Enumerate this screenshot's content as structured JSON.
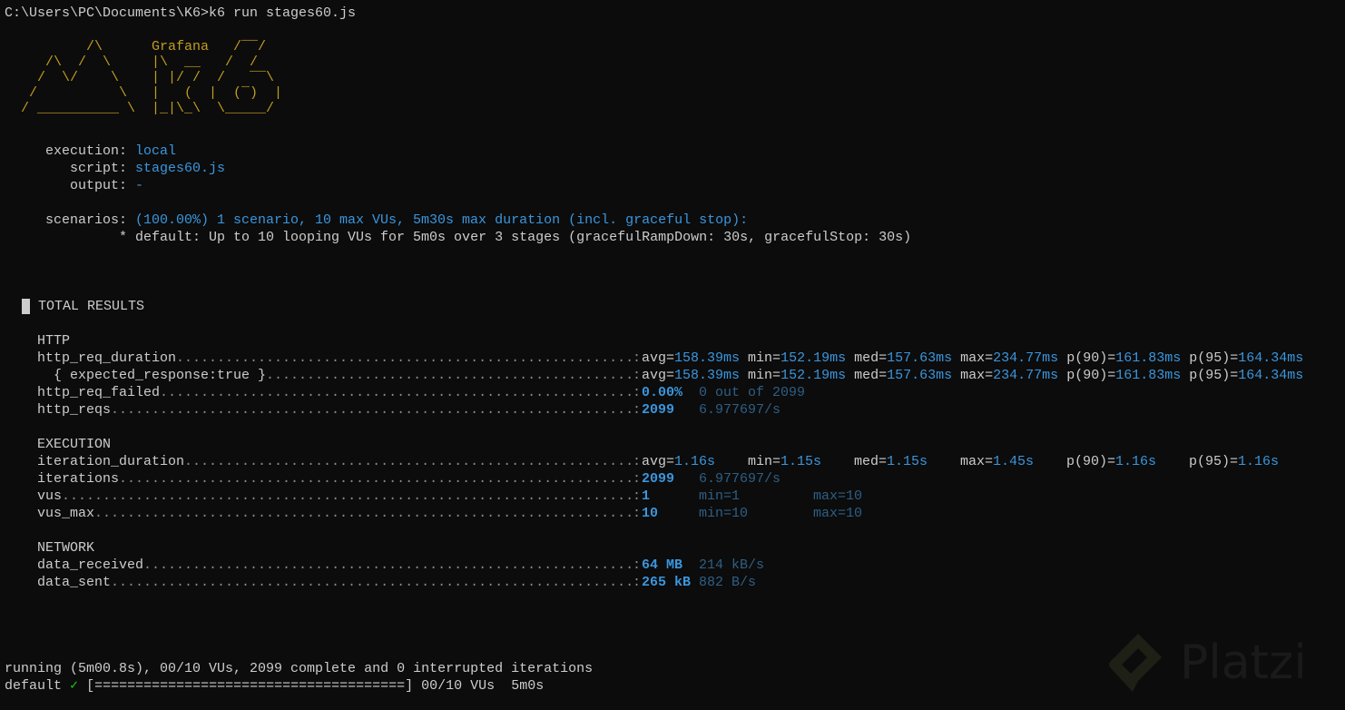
{
  "command_line": "C:\\Users\\PC\\Documents\\K6>k6 run stages60.js",
  "logo": {
    "lines": [
      "          /\\      Grafana   /‾‾/",
      "     /\\  /  \\     |\\  __   /  /",
      "    /  \\/    \\    | |/ /  /   ‾‾\\",
      "   /          \\   |   (  |  (‾)  |",
      "  / __________ \\  |_|\\_\\  \\_____/"
    ]
  },
  "info": {
    "execution_label": "execution:",
    "execution": "local",
    "script_label": "script:",
    "script": "stages60.js",
    "output_label": "output:",
    "output": "-",
    "scenarios_label": "scenarios:",
    "scenarios": "(100.00%) 1 scenario, 10 max VUs, 5m30s max duration (incl. graceful stop):",
    "default_line": "* default: Up to 10 looping VUs for 5m0s over 3 stages (gracefulRampDown: 30s, gracefulStop: 30s)"
  },
  "results_title": "TOTAL RESULTS",
  "http": {
    "title": "HTTP",
    "req_duration": {
      "name": "http_req_duration",
      "avg": "158.39ms",
      "min": "152.19ms",
      "med": "157.63ms",
      "max": "234.77ms",
      "p90": "161.83ms",
      "p95": "164.34ms"
    },
    "expected": {
      "name": "{ expected_response:true }",
      "avg": "158.39ms",
      "min": "152.19ms",
      "med": "157.63ms",
      "max": "234.77ms",
      "p90": "161.83ms",
      "p95": "164.34ms"
    },
    "req_failed": {
      "name": "http_req_failed",
      "value": "0.00%",
      "extra": "0 out of 2099"
    },
    "reqs": {
      "name": "http_reqs",
      "value": "2099",
      "extra": "6.977697/s"
    }
  },
  "execution": {
    "title": "EXECUTION",
    "iteration_duration": {
      "name": "iteration_duration",
      "avg": "1.16s",
      "min": "1.15s",
      "med": "1.15s",
      "max": "1.45s",
      "p90": "1.16s",
      "p95": "1.16s"
    },
    "iterations": {
      "name": "iterations",
      "value": "2099",
      "extra": "6.977697/s"
    },
    "vus": {
      "name": "vus",
      "value": "1",
      "min": "min=1",
      "max": "max=10"
    },
    "vus_max": {
      "name": "vus_max",
      "value": "10",
      "min": "min=10",
      "max": "max=10"
    }
  },
  "network": {
    "title": "NETWORK",
    "data_received": {
      "name": "data_received",
      "value": "64 MB",
      "extra": "214 kB/s"
    },
    "data_sent": {
      "name": "data_sent",
      "value": "265 kB",
      "extra": "882 B/s"
    }
  },
  "labels": {
    "avg": "avg=",
    "min": "min=",
    "med": "med=",
    "max": "max=",
    "p90": "p(90)=",
    "p95": "p(95)=",
    "colon": ":"
  },
  "status": {
    "running": "running (5m00.8s), 00/10 VUs, 2099 complete and 0 interrupted iterations",
    "default_label": "default",
    "check": "✓",
    "progress_bar": "[======================================]",
    "progress": 1.0,
    "vus": "00/10 VUs",
    "duration": "5m0s"
  },
  "watermark": "Platzi",
  "colors": {
    "background": "#0c0c0c",
    "text": "#cccccc",
    "accent": "#3a96dd",
    "logo": "#c19c1f",
    "ok": "#16c60c"
  }
}
